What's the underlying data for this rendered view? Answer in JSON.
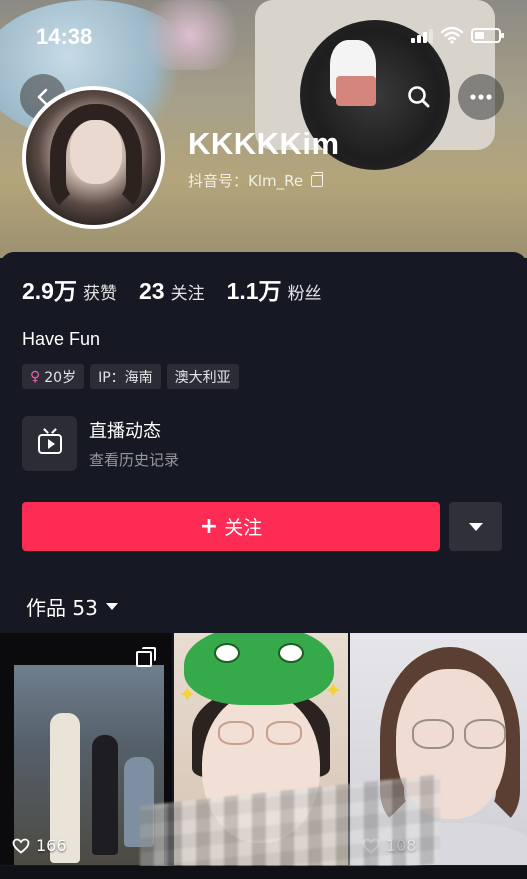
{
  "status_bar": {
    "time": "14:38"
  },
  "profile": {
    "username": "KKKKKim",
    "douyin_id_label": "抖音号：Klm_Re",
    "stats": [
      {
        "num": "2.9万",
        "label": "获赞"
      },
      {
        "num": "23",
        "label": "关注"
      },
      {
        "num": "1.1万",
        "label": "粉丝"
      }
    ],
    "bio": "Have Fun",
    "tags": {
      "age": "20岁",
      "ip": "IP：海南",
      "location": "澳大利亚"
    },
    "live": {
      "title": "直播动态",
      "subtitle": "查看历史记录"
    },
    "follow_label": "关注",
    "works_label": "作品 53"
  },
  "videos": [
    {
      "likes": "166",
      "pinned": true
    },
    {
      "likes": ""
    },
    {
      "likes": "108"
    }
  ],
  "colors": {
    "accent": "#fe2c55",
    "background": "#161823",
    "tag_bg": "#2b2c36",
    "female": "#ef62a8"
  },
  "icons": [
    "back-icon",
    "search-icon",
    "more-icon",
    "copy-icon",
    "female-icon",
    "tv-icon",
    "plus-icon",
    "caret-down-icon",
    "heart-icon",
    "pin-icon"
  ]
}
